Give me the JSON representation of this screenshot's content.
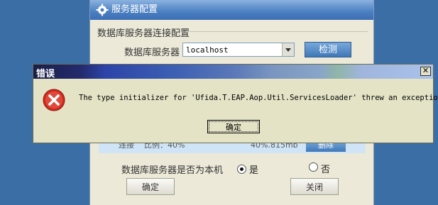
{
  "background_window": {
    "title": "服务器配置",
    "group_title": "数据库服务器连接配置",
    "server_label": "数据库服务器",
    "server_value": "localhost",
    "detect_button": "检测",
    "partial_row": {
      "col1": "连接",
      "col2": "比例：40%",
      "col3": "40%.815mb",
      "delete_button": "删除"
    },
    "is_local_label": "数据库服务器是否为本机",
    "radio_yes": "是",
    "radio_no": "否",
    "radio_selected": "yes",
    "ok_button": "确定",
    "close_button": "关闭"
  },
  "error_dialog": {
    "title": "错误",
    "close_symbol": "✕",
    "icon": "error-icon",
    "message": "The type initializer for 'Ufida.T.EAP.Aop.Util.ServicesLoader' threw an exception.",
    "ok_button": "确定"
  },
  "colors": {
    "desktop": "#3a6ea5",
    "dialog_bg": "#e4e3c6",
    "error_red": "#d22a1f"
  }
}
